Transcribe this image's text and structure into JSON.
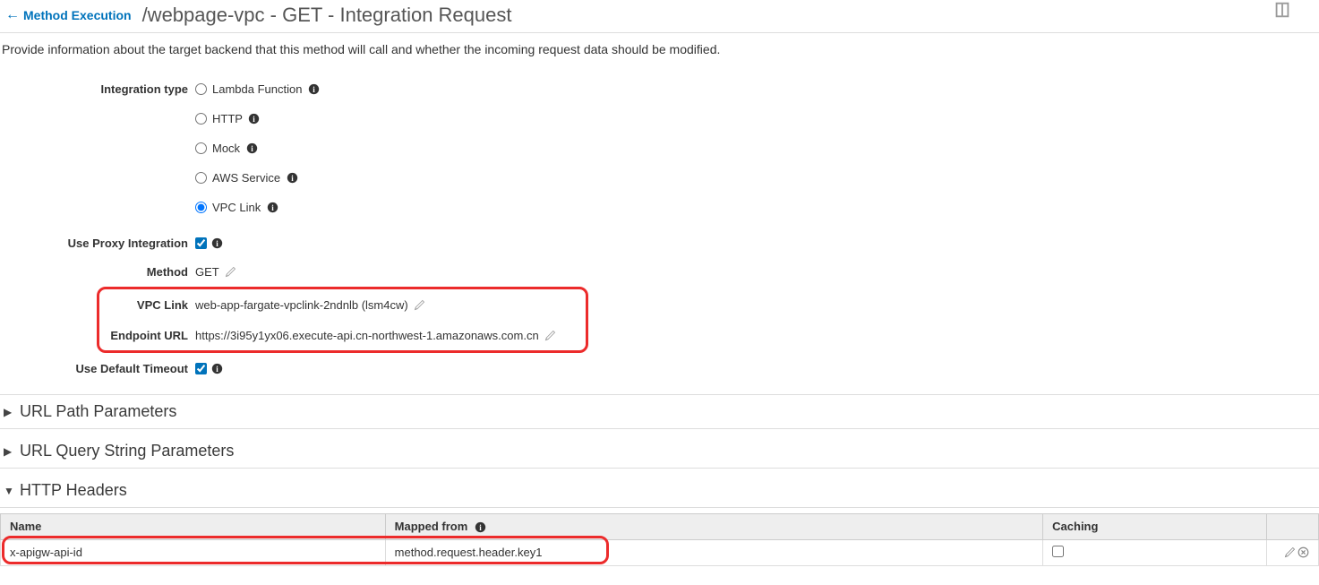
{
  "header": {
    "back_link": "Method Execution",
    "title": "/webpage-vpc - GET - Integration Request"
  },
  "description": "Provide information about the target backend that this method will call and whether the incoming request data should be modified.",
  "form": {
    "integration_type_label": "Integration type",
    "integration_options": {
      "lambda": "Lambda Function",
      "http": "HTTP",
      "mock": "Mock",
      "aws_service": "AWS Service",
      "vpc_link": "VPC Link"
    },
    "selected_integration": "vpc_link",
    "use_proxy_label": "Use Proxy Integration",
    "use_proxy_checked": true,
    "method_label": "Method",
    "method_value": "GET",
    "vpc_link_label": "VPC Link",
    "vpc_link_value": "web-app-fargate-vpclink-2ndnlb (lsm4cw)",
    "endpoint_url_label": "Endpoint URL",
    "endpoint_url_value": "https://3i95y1yx06.execute-api.cn-northwest-1.amazonaws.com.cn",
    "use_default_timeout_label": "Use Default Timeout",
    "use_default_timeout_checked": true
  },
  "sections": {
    "url_path_params": "URL Path Parameters",
    "url_query_params": "URL Query String Parameters",
    "http_headers": "HTTP Headers"
  },
  "headers_table": {
    "columns": {
      "name": "Name",
      "mapped_from": "Mapped from",
      "caching": "Caching"
    },
    "rows": [
      {
        "name": "x-apigw-api-id",
        "mapped_from": "method.request.header.key1",
        "caching": false
      }
    ]
  }
}
